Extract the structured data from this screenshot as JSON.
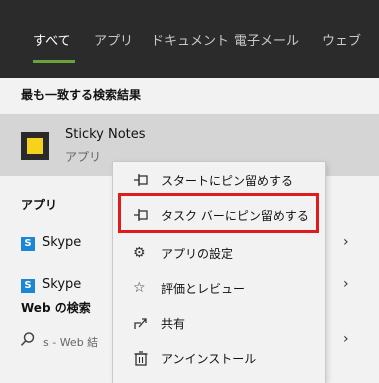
{
  "tabs": [
    {
      "label": "すべて",
      "active": true
    },
    {
      "label": "アプリ",
      "active": false
    },
    {
      "label": "ドキュメント",
      "active": false
    },
    {
      "label": "電子メール",
      "active": false
    },
    {
      "label": "ウェブ",
      "active": false
    }
  ],
  "sections": {
    "best_match": "最も一致する検索結果",
    "apps": "アプリ",
    "web_search": "Web の検索"
  },
  "best_match": {
    "name": "Sticky Notes",
    "type": "アプリ",
    "icon": "sticky-notes-icon"
  },
  "app_results": [
    {
      "label": "Skype",
      "icon": "skype-icon"
    },
    {
      "label": "Skype",
      "icon": "skype-icon"
    }
  ],
  "web_result": {
    "text": "s - Web 結"
  },
  "context_menu": {
    "items": [
      {
        "label": "スタートにピン留めする",
        "icon": "pin-icon"
      },
      {
        "label": "タスク バーにピン留めする",
        "icon": "pin-icon",
        "highlighted": true
      },
      {
        "label": "アプリの設定",
        "icon": "gear-icon"
      },
      {
        "label": "評価とレビュー",
        "icon": "star-icon"
      },
      {
        "label": "共有",
        "icon": "share-icon"
      },
      {
        "label": "アンインストール",
        "icon": "trash-icon"
      }
    ]
  },
  "colors": {
    "topbar_bg": "#2b2b2b",
    "accent": "#67a33a",
    "highlight_border": "#e01b1b",
    "sticky_yellow": "#f7d21c",
    "skype_blue": "#1b86d6"
  }
}
